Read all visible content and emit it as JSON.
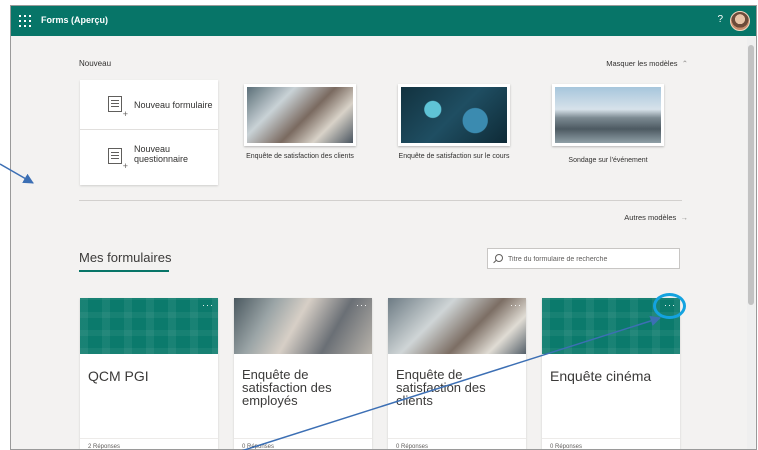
{
  "app": {
    "title": "Forms (Aperçu)",
    "help_label": "?"
  },
  "nouveau": {
    "title": "Nouveau",
    "hide_templates": "Masquer les modèles",
    "new_form": "Nouveau formulaire",
    "new_quiz": "Nouveau questionnaire",
    "templates": [
      {
        "caption": "Enquête de satisfaction des clients"
      },
      {
        "caption": "Enquête de satisfaction sur le cours"
      },
      {
        "caption": "Sondage sur l'événement"
      }
    ],
    "more_templates": "Autres modèles"
  },
  "mes_formulaires": {
    "title": "Mes formulaires",
    "search_placeholder": "Titre du formulaire de recherche",
    "cards": [
      {
        "title": "QCM PGI",
        "responses": "2 Réponses",
        "more_label": "···"
      },
      {
        "title": "Enquête de satisfaction des employés",
        "responses": "0 Réponses",
        "more_label": "···"
      },
      {
        "title": "Enquête de satisfaction des clients",
        "responses": "0 Réponses",
        "more_label": "···"
      },
      {
        "title": "Enquête cinéma",
        "responses": "0 Réponses",
        "more_label": "···"
      }
    ]
  },
  "colors": {
    "accent": "#077568",
    "annotation": "#13a3e0",
    "arrow": "#3c6fb4"
  }
}
